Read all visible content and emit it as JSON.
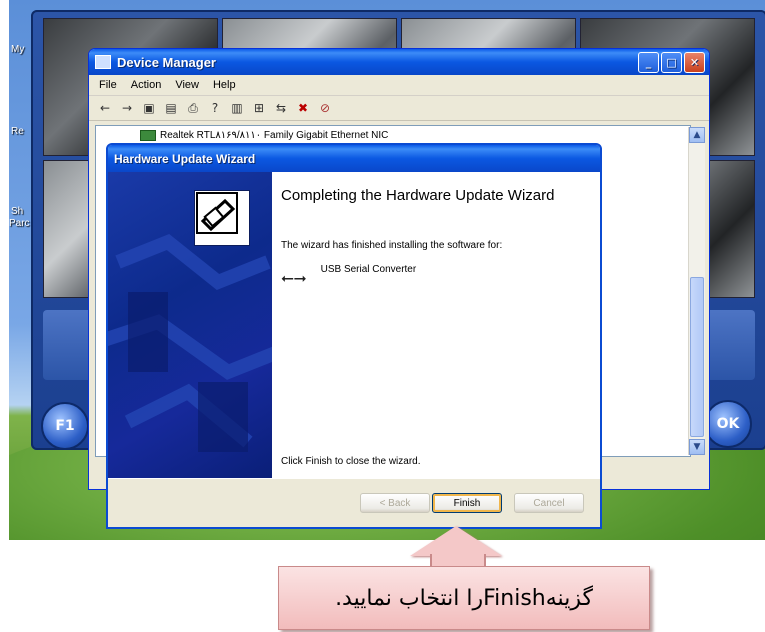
{
  "desktop": {
    "labels": [
      "My",
      "Re",
      "Sh",
      "Parc"
    ]
  },
  "viewer": {
    "left_button_label": "F1",
    "ok_button_label": "OK"
  },
  "device_manager": {
    "title": "Device Manager",
    "menu": [
      "File",
      "Action",
      "View",
      "Help"
    ],
    "tree_item": "Realtek RTL۸۱۶۹/۸۱۱۰ Family Gigabit Ethernet NIC"
  },
  "wizard": {
    "title": "Hardware Update Wizard",
    "heading": "Completing the Hardware Update Wizard",
    "message": "The wizard has finished installing the software for:",
    "device_name": "USB Serial Converter",
    "close_hint": "Click Finish to close the wizard.",
    "buttons": {
      "back": "< Back",
      "finish": "Finish",
      "cancel": "Cancel"
    }
  },
  "annotation": {
    "text": "گزینهFinishرا انتخاب نمایید."
  }
}
